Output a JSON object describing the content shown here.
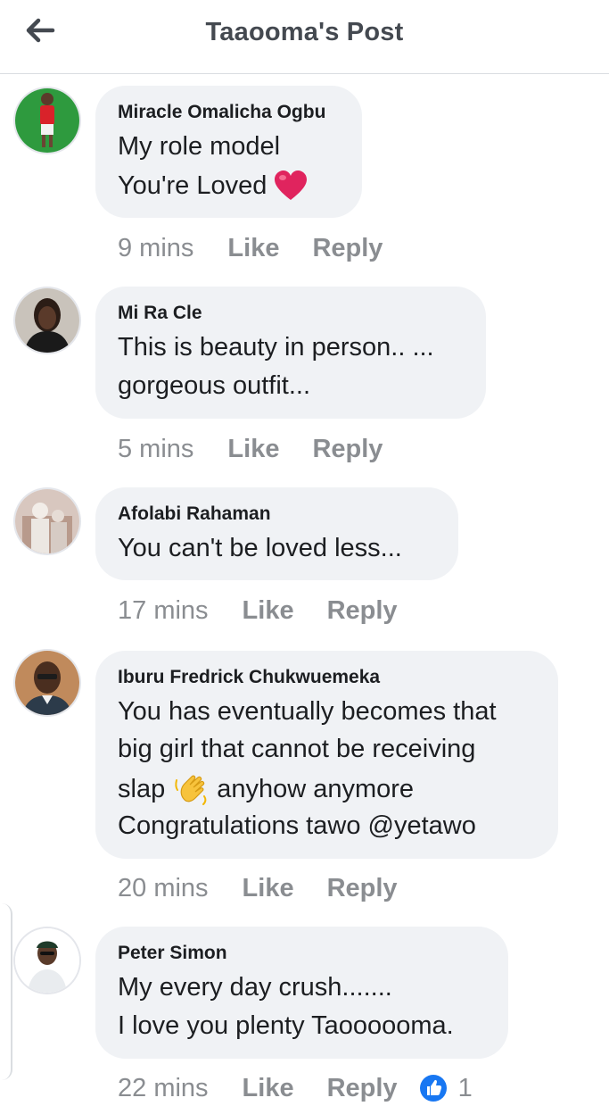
{
  "header": {
    "title": "Taaooma's Post"
  },
  "comments": [
    {
      "author": "Miracle Omalicha Ogbu",
      "lines": [
        "My role model",
        "You're Loved"
      ],
      "time": "9 mins",
      "like": "Like",
      "reply": "Reply"
    },
    {
      "author": "Mi Ra Cle",
      "lines": [
        "This is beauty in person.. ...",
        "gorgeous outfit..."
      ],
      "time": "5 mins",
      "like": "Like",
      "reply": "Reply"
    },
    {
      "author": "Afolabi Rahaman",
      "lines": [
        "You can't be loved less..."
      ],
      "time": "17 mins",
      "like": "Like",
      "reply": "Reply"
    },
    {
      "author": "Iburu Fredrick Chukwuemeka",
      "lines": [
        "You has eventually becomes that",
        "big girl that cannot be receiving",
        "slap",
        "anyhow anymore",
        "Congratulations tawo @yetawo"
      ],
      "time": "20 mins",
      "like": "Like",
      "reply": "Reply"
    },
    {
      "author": "Peter Simon",
      "lines": [
        "My every day crush.......",
        "I love you plenty Taoooooma."
      ],
      "time": "22 mins",
      "like": "Like",
      "reply": "Reply",
      "reaction_count": "1"
    }
  ],
  "colors": {
    "accent": "#1877f2",
    "bubble": "#f0f2f5",
    "muted": "#8a8d91",
    "heart": "#e0245e"
  },
  "icons": {
    "back": "arrow-left-icon",
    "heart": "heart-emoji-icon",
    "wave": "waving-hand-emoji-icon",
    "like_reaction": "thumbs-up-icon"
  }
}
